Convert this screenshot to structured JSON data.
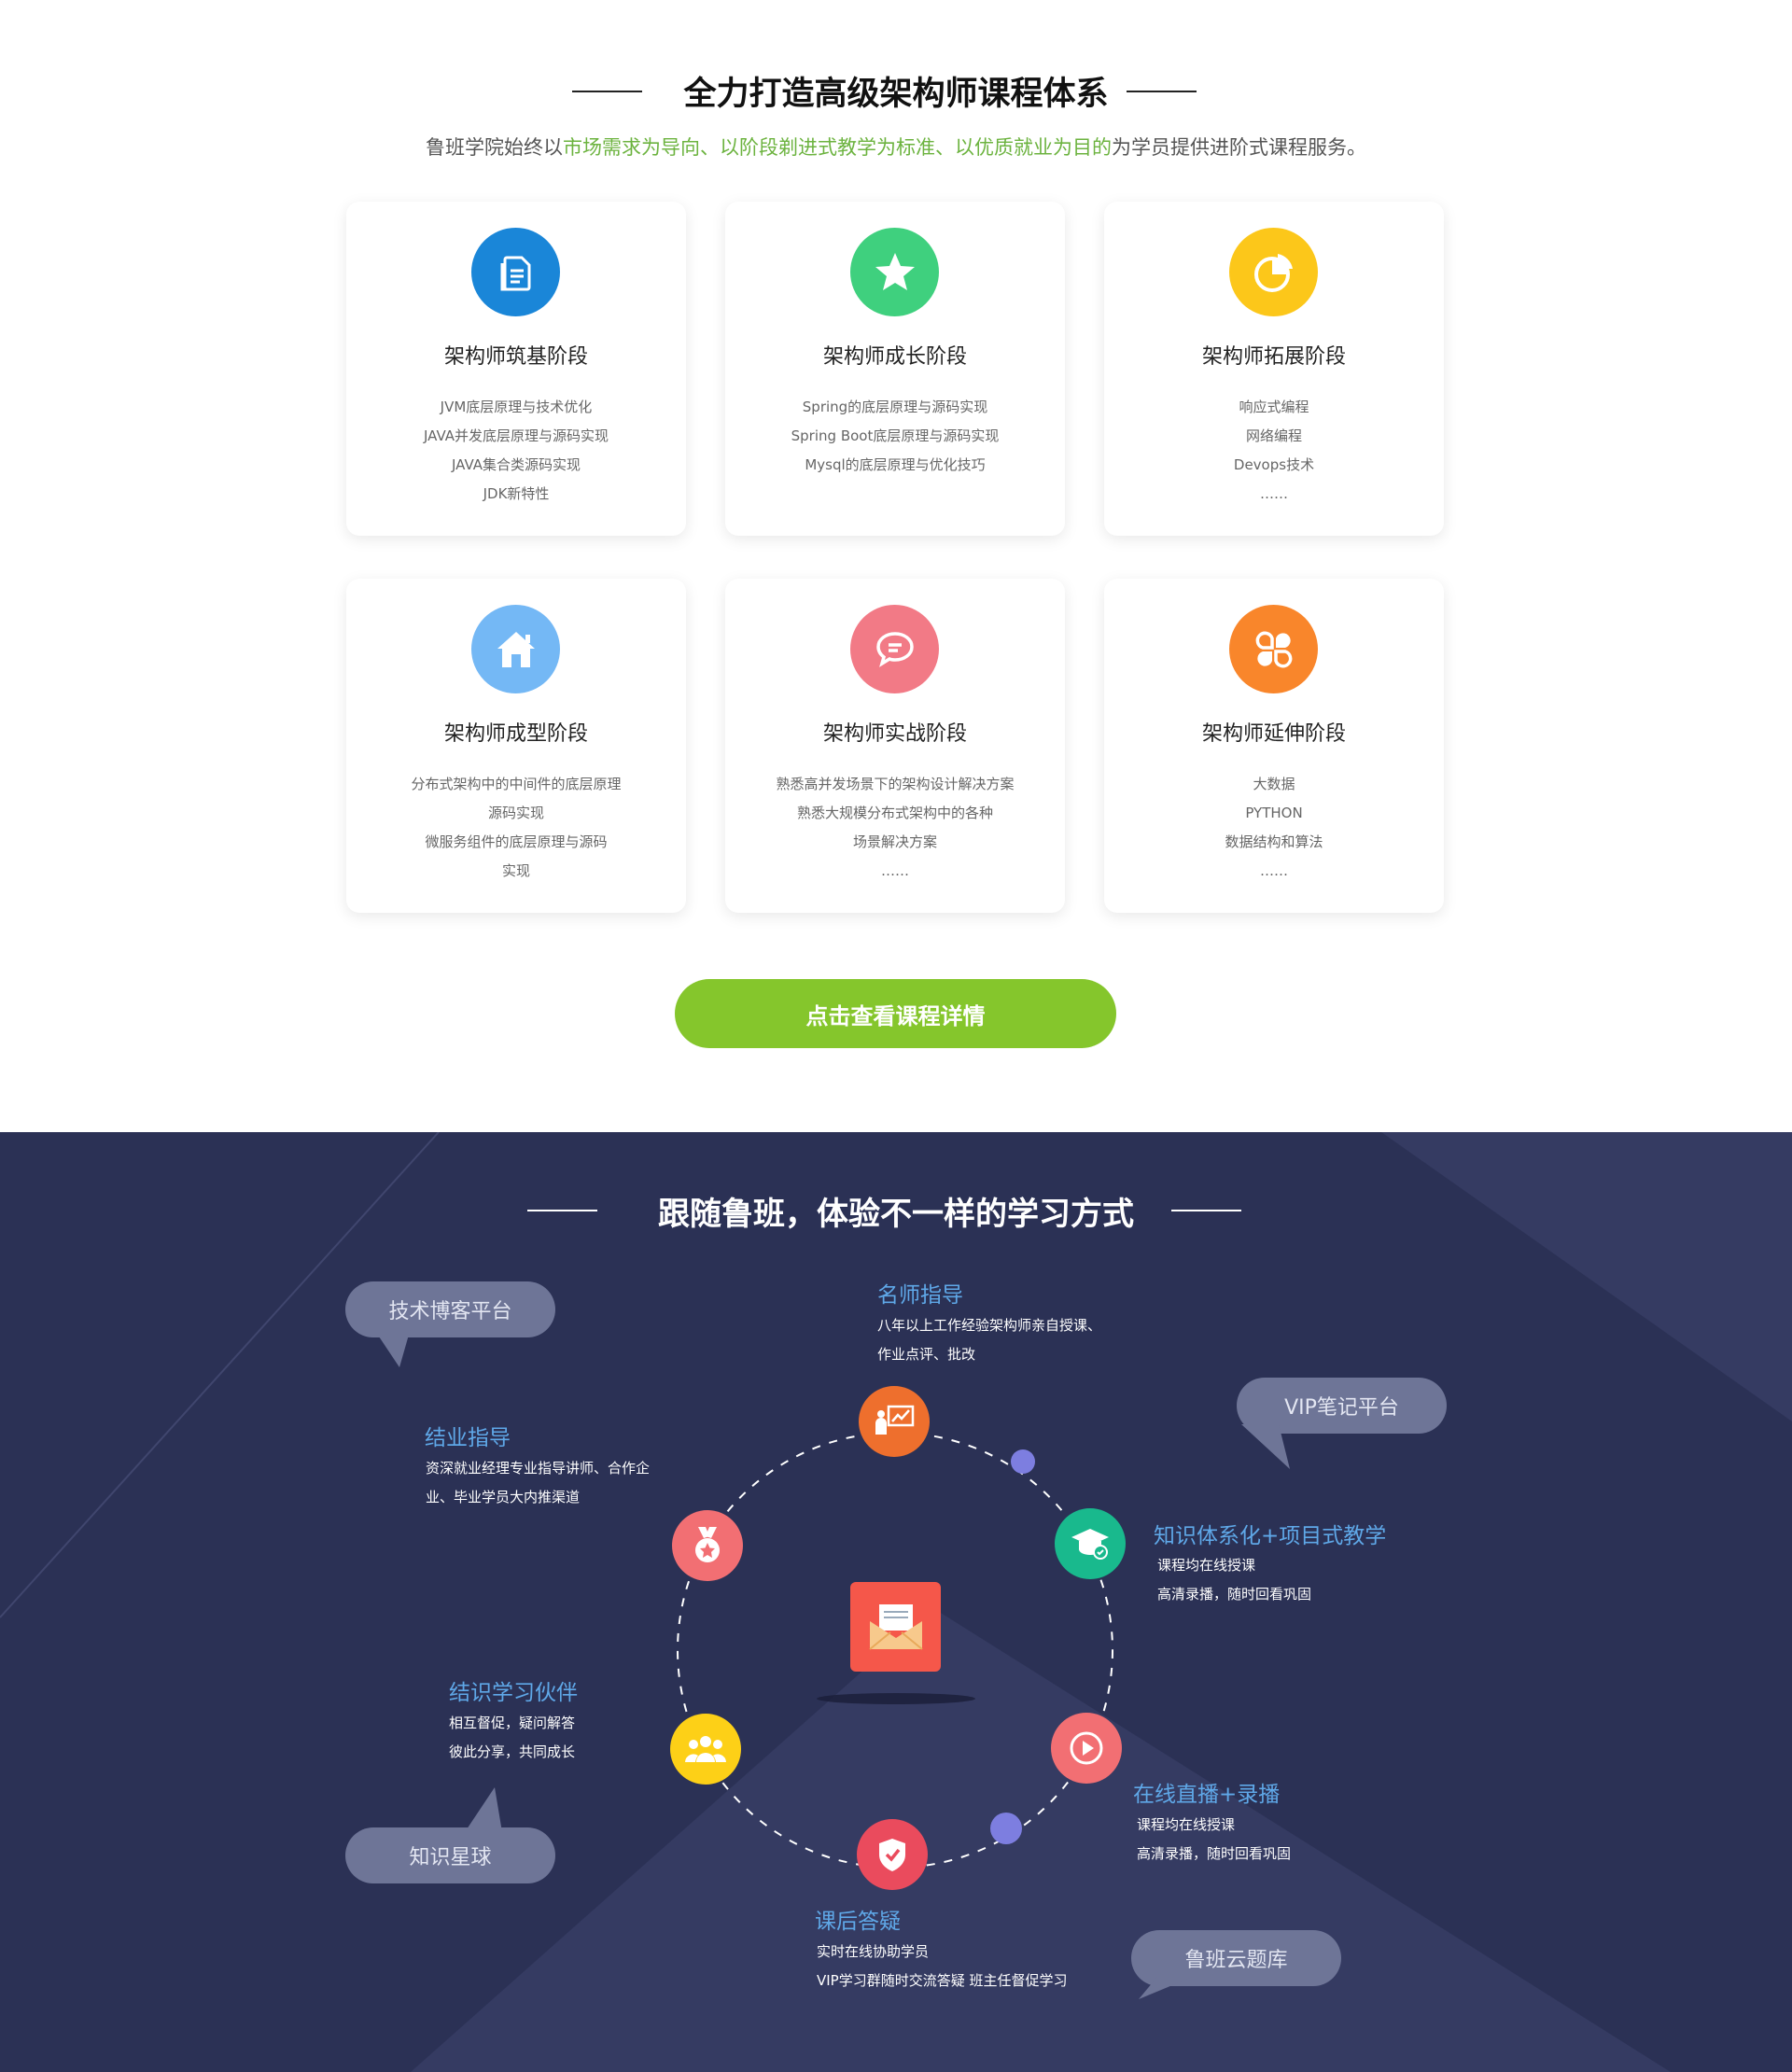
{
  "section1": {
    "title": "全力打造高级架构师课程体系",
    "subtitle": {
      "prefix": "鲁班学院始终以",
      "highlight": "市场需求为导向、以阶段剃进式教学为标准、以优质就业为目的",
      "suffix": "为学员提供进阶式课程服务。"
    },
    "cards": [
      {
        "title": "架构师筑基阶段",
        "icon": "document-icon",
        "color": "#1a86d8",
        "items": [
          "JVM底层原理与技术优化",
          "JAVA并发底层原理与源码实现",
          "JAVA集合类源码实现",
          "JDK新特性"
        ]
      },
      {
        "title": "架构师成长阶段",
        "icon": "star-icon",
        "color": "#3fd07e",
        "items": [
          "Spring的底层原理与源码实现",
          "Spring Boot底层原理与源码实现",
          "Mysql的底层原理与优化技巧"
        ]
      },
      {
        "title": "架构师拓展阶段",
        "icon": "pie-chart-icon",
        "color": "#fcc71a",
        "items": [
          "响应式编程",
          "网络编程",
          "Devops技术",
          "……"
        ]
      },
      {
        "title": "架构师成型阶段",
        "icon": "home-icon",
        "color": "#74b8f5",
        "items": [
          "分布式架构中的中间件的底层原理",
          "源码实现",
          "微服务组件的底层原理与源码",
          "实现"
        ]
      },
      {
        "title": "架构师实战阶段",
        "icon": "chat-icon",
        "color": "#f27a86",
        "items": [
          "熟悉高并发场景下的架构设计解决方案",
          "熟悉大规模分布式架构中的各种",
          "场景解决方案",
          "……"
        ]
      },
      {
        "title": "架构师延伸阶段",
        "icon": "clover-icon",
        "color": "#f9862b",
        "items": [
          "大数据",
          "PYTHON",
          "数据结构和算法",
          "……"
        ]
      }
    ],
    "cta_label": "点击查看课程详情"
  },
  "section2": {
    "title": "跟随鲁班，体验不一样的学习方式",
    "bubbles": {
      "blog": "技术博客平台",
      "notes": "VIP笔记平台",
      "planet": "知识星球",
      "cloud": "鲁班云题库"
    },
    "features": {
      "mentor": {
        "title": "名师指导",
        "lines": [
          "八年以上工作经验架构师亲自授课、",
          "作业点评、批改"
        ]
      },
      "career": {
        "title": "结业指导",
        "lines": [
          "资深就业经理专业指导讲师、合作企",
          "业、毕业学员大内推渠道"
        ]
      },
      "system": {
        "title": "知识体系化+项目式教学",
        "lines": [
          "课程均在线授课",
          "高清录播，随时回看巩固"
        ]
      },
      "partner": {
        "title": "结识学习伙伴",
        "lines": [
          "相互督促，疑问解答",
          "彼此分享，共同成长"
        ]
      },
      "live": {
        "title": "在线直播+录播",
        "lines": [
          "课程均在线授课",
          "高清录播，随时回看巩固"
        ]
      },
      "qa": {
        "title": "课后答疑",
        "lines": [
          "实时在线协助学员",
          "VIP学习群随时交流答疑   班主任督促学习"
        ]
      }
    },
    "node_colors": {
      "mentor": "#ee6f2d",
      "system": "#19b98d",
      "live": "#f26f73",
      "qa": "#ea4b5d",
      "partner": "#fdd017",
      "career": "#f26f73",
      "center": "#f5574a"
    }
  }
}
